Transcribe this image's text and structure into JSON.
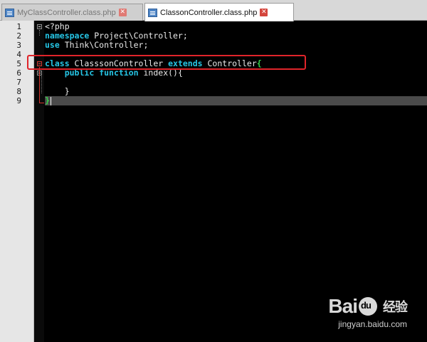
{
  "tabs": [
    {
      "label": "MyClassController.class.php",
      "close": "✕"
    },
    {
      "label": "ClassonController.class.php",
      "close": "✕"
    }
  ],
  "line_numbers": [
    "1",
    "2",
    "3",
    "4",
    "5",
    "6",
    "7",
    "8",
    "9"
  ],
  "code": {
    "l1": "<?php",
    "l2_kw": "namespace",
    "l2_rest": " Project\\Controller;",
    "l3_kw": "use",
    "l3_rest": " Think\\Controller;",
    "l5_kw1": "class",
    "l5_mid": " ClasssonController ",
    "l5_kw2": "extends",
    "l5_rest": " Controller",
    "l5_brace": "{",
    "l6_indent": "    ",
    "l6_kw1": "public",
    "l6_kw2": "function",
    "l6_rest": " index(){",
    "l8": "    }",
    "l9_brace": "}"
  },
  "watermark": {
    "logo_left": "Bai",
    "logo_cn": "经验",
    "url": "jingyan.baidu.com"
  },
  "colors": {
    "keyword": "#26c6e6",
    "brace": "#36d34a",
    "highlight_box": "#e0242a",
    "editor_bg": "#000000"
  },
  "icons": [
    "file-php-icon",
    "close-tab-icon",
    "fold-minus-icon"
  ]
}
